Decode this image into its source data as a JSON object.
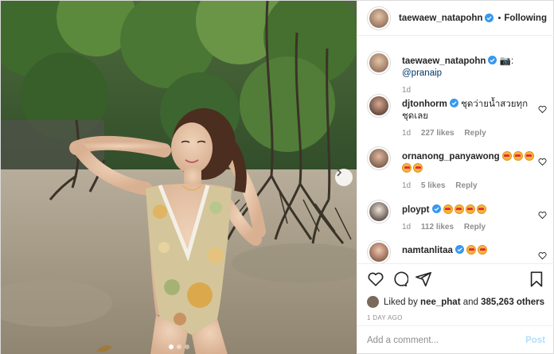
{
  "post": {
    "author": "taewaew_natapohn",
    "follow_separator": "•",
    "follow_status": "Following",
    "caption_prefix": "📷:",
    "caption_mention": "@pranaip",
    "caption_time": "1d"
  },
  "comments": [
    {
      "username": "djtonhorm",
      "verified": true,
      "text": "ชุดว่ายน้ำสวยทุกชุดเลย",
      "time": "1d",
      "likes": "227 likes",
      "reply": "Reply",
      "emoji_count": 0
    },
    {
      "username": "ornanong_panyawong",
      "verified": false,
      "text": "",
      "time": "1d",
      "likes": "5 likes",
      "reply": "Reply",
      "emoji_count": 5
    },
    {
      "username": "ploypt",
      "verified": true,
      "text": "",
      "time": "1d",
      "likes": "112 likes",
      "reply": "Reply",
      "emoji_count": 4
    },
    {
      "username": "namtanlitaa",
      "verified": true,
      "text": "",
      "time": "",
      "likes": "",
      "reply": "",
      "emoji_count": 2
    }
  ],
  "likes": {
    "prefix": "Liked by",
    "user": "nee_phat",
    "conjunction": "and",
    "others": "385,263 others"
  },
  "timestamp": "1 DAY AGO",
  "comment_box": {
    "placeholder": "Add a comment...",
    "post_label": "Post"
  },
  "carousel": {
    "slides": 3,
    "active": 0
  },
  "colors": {
    "accent_blue": "#0095f6",
    "post_disabled": "#b2dffc",
    "verified": "#3897f0",
    "muted": "#8e8e8e"
  },
  "icons": [
    "heart-icon",
    "comment-icon",
    "share-icon",
    "bookmark-icon",
    "verified-badge-icon",
    "chevron-right-icon"
  ]
}
